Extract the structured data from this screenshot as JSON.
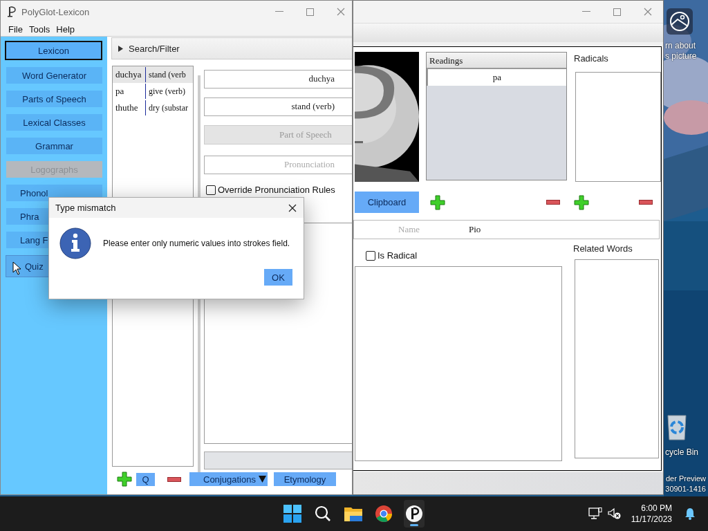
{
  "back_window": {
    "readings": {
      "header": "Readings",
      "rows": [
        {
          "text": "pa",
          "selected": true
        }
      ]
    },
    "radicals_label": "Radicals",
    "clipboard_button": "Clipboard",
    "name_field": {
      "placeholder": "Name",
      "value": "Pio"
    },
    "is_radical": {
      "label": "Is Radical",
      "checked": false
    },
    "related_words_label": "Related Words"
  },
  "main_window": {
    "title": "PolyGlot-Lexicon",
    "menu": [
      "File",
      "Tools",
      "Help"
    ],
    "sidebar": [
      {
        "label": "Lexicon",
        "selected": true,
        "disabled": false,
        "hovered": false,
        "kind": "full"
      },
      {
        "label": "Word Generator",
        "selected": false,
        "disabled": false,
        "hovered": false,
        "kind": "full"
      },
      {
        "label": "Parts of Speech",
        "selected": false,
        "disabled": false,
        "hovered": false,
        "kind": "full"
      },
      {
        "label": "Lexical Classes",
        "selected": false,
        "disabled": false,
        "hovered": false,
        "kind": "full"
      },
      {
        "label": "Grammar",
        "selected": false,
        "disabled": false,
        "hovered": false,
        "kind": "full"
      },
      {
        "label": "Logographs",
        "selected": false,
        "disabled": true,
        "hovered": false,
        "kind": "full"
      },
      {
        "label": "Phonol",
        "selected": false,
        "disabled": false,
        "hovered": false,
        "kind": "cut"
      },
      {
        "label": "Phra",
        "selected": false,
        "disabled": false,
        "hovered": false,
        "kind": "cut"
      },
      {
        "label": "Lang F",
        "selected": false,
        "disabled": false,
        "hovered": false,
        "kind": "cut"
      },
      {
        "label": "Quiz",
        "selected": false,
        "disabled": false,
        "hovered": true,
        "kind": "cut"
      }
    ],
    "search_filter": {
      "label": "Search/Filter",
      "expanded": false
    },
    "words": [
      {
        "conword": "duchya",
        "local": "stand (verb",
        "selected": true
      },
      {
        "conword": "pa",
        "local": "give (verb)",
        "selected": false
      },
      {
        "conword": "thuthe",
        "local": "dry (substar",
        "selected": false
      }
    ],
    "conword_field": {
      "value": "duchya"
    },
    "local_field": {
      "value": "stand (verb)"
    },
    "part_of_speech_button": "Part of Speech",
    "pronunciation_field": {
      "placeholder": "Pronunciation"
    },
    "override_pronunciation": {
      "label": "Override Pronunciation Rules",
      "checked": false
    },
    "quick_button": "Q",
    "conjugations_button": "Conjugations",
    "etymology_button": "Etymology"
  },
  "dialog": {
    "title": "Type mismatch",
    "message": "Please enter only numeric values into strokes field.",
    "ok_button": "OK"
  },
  "desktop": {
    "spotlight_lines": [
      "rn about",
      "s picture"
    ],
    "recycle_bin_label": "cycle Bin",
    "build_lines": [
      "der Preview",
      "30901-1416"
    ]
  },
  "taskbar": {
    "apps": [
      {
        "kind": "start",
        "active": false
      },
      {
        "kind": "search",
        "active": false
      },
      {
        "kind": "folder",
        "active": false
      },
      {
        "kind": "chrome",
        "active": false
      },
      {
        "kind": "polyglot",
        "active": true
      }
    ],
    "time": "6:00 PM",
    "date": "11/17/2023"
  }
}
